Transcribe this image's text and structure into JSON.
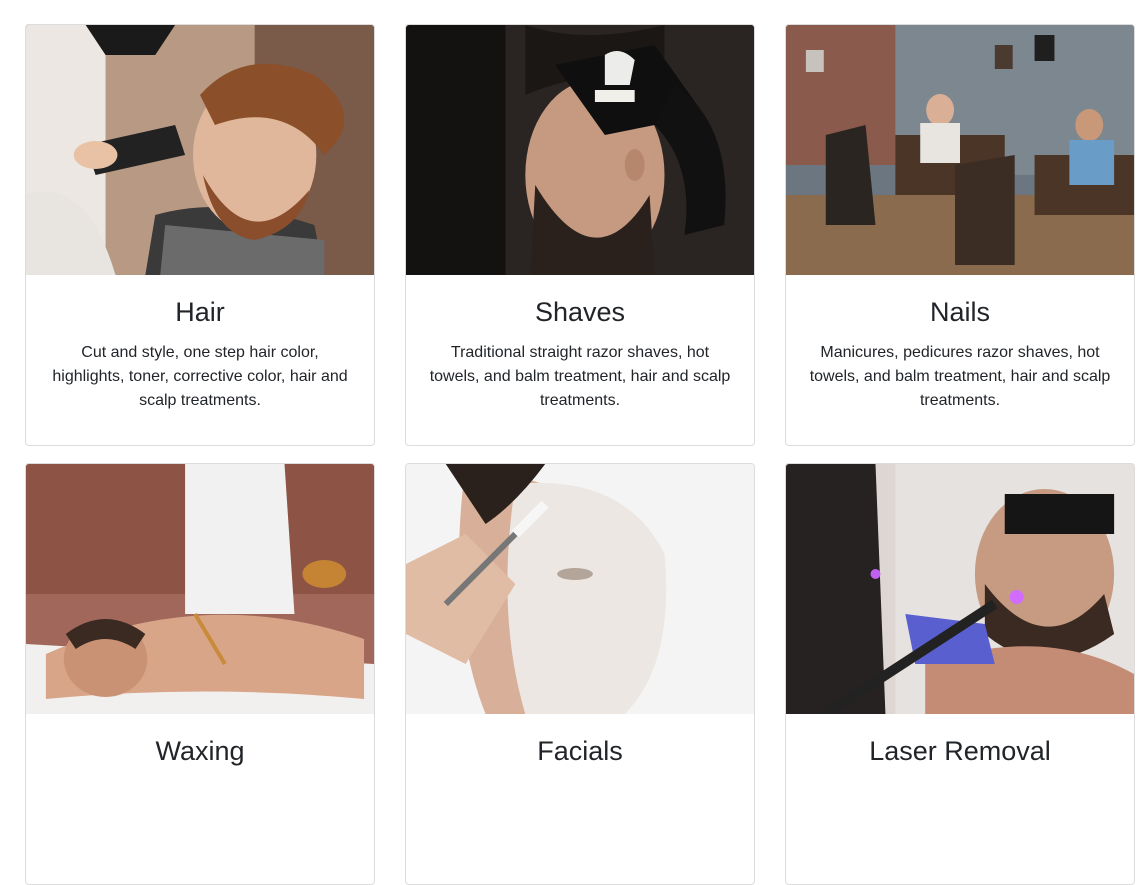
{
  "services": [
    {
      "title": "Hair",
      "description": "Cut and style, one step hair color, highlights, toner, corrective color, hair and scalp treatments.",
      "image": "barber-haircut-photo"
    },
    {
      "title": "Shaves",
      "description": "Traditional straight razor shaves, hot towels, and balm treatment, hair and scalp treatments.",
      "image": "straight-razor-shave-photo"
    },
    {
      "title": "Nails",
      "description": "Manicures, pedicures razor shaves, hot towels, and balm treatment, hair and scalp treatments.",
      "image": "salon-pedicure-photo"
    },
    {
      "title": "Waxing",
      "description": "",
      "image": "chest-waxing-photo"
    },
    {
      "title": "Facials",
      "description": "",
      "image": "facial-mask-photo"
    },
    {
      "title": "Laser Removal",
      "description": "",
      "image": "laser-hair-removal-photo"
    }
  ]
}
